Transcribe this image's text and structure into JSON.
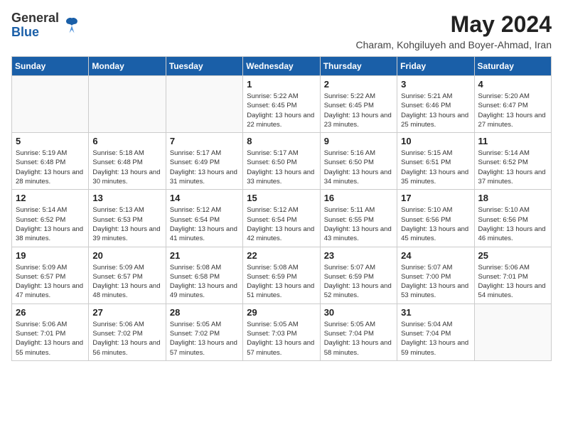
{
  "logo": {
    "general": "General",
    "blue": "Blue"
  },
  "title": "May 2024",
  "location": "Charam, Kohgiluyeh and Boyer-Ahmad, Iran",
  "days_of_week": [
    "Sunday",
    "Monday",
    "Tuesday",
    "Wednesday",
    "Thursday",
    "Friday",
    "Saturday"
  ],
  "weeks": [
    [
      {
        "day": "",
        "info": ""
      },
      {
        "day": "",
        "info": ""
      },
      {
        "day": "",
        "info": ""
      },
      {
        "day": "1",
        "sunrise": "5:22 AM",
        "sunset": "6:45 PM",
        "daylight": "13 hours and 22 minutes."
      },
      {
        "day": "2",
        "sunrise": "5:22 AM",
        "sunset": "6:45 PM",
        "daylight": "13 hours and 23 minutes."
      },
      {
        "day": "3",
        "sunrise": "5:21 AM",
        "sunset": "6:46 PM",
        "daylight": "13 hours and 25 minutes."
      },
      {
        "day": "4",
        "sunrise": "5:20 AM",
        "sunset": "6:47 PM",
        "daylight": "13 hours and 27 minutes."
      }
    ],
    [
      {
        "day": "5",
        "sunrise": "5:19 AM",
        "sunset": "6:48 PM",
        "daylight": "13 hours and 28 minutes."
      },
      {
        "day": "6",
        "sunrise": "5:18 AM",
        "sunset": "6:48 PM",
        "daylight": "13 hours and 30 minutes."
      },
      {
        "day": "7",
        "sunrise": "5:17 AM",
        "sunset": "6:49 PM",
        "daylight": "13 hours and 31 minutes."
      },
      {
        "day": "8",
        "sunrise": "5:17 AM",
        "sunset": "6:50 PM",
        "daylight": "13 hours and 33 minutes."
      },
      {
        "day": "9",
        "sunrise": "5:16 AM",
        "sunset": "6:50 PM",
        "daylight": "13 hours and 34 minutes."
      },
      {
        "day": "10",
        "sunrise": "5:15 AM",
        "sunset": "6:51 PM",
        "daylight": "13 hours and 35 minutes."
      },
      {
        "day": "11",
        "sunrise": "5:14 AM",
        "sunset": "6:52 PM",
        "daylight": "13 hours and 37 minutes."
      }
    ],
    [
      {
        "day": "12",
        "sunrise": "5:14 AM",
        "sunset": "6:52 PM",
        "daylight": "13 hours and 38 minutes."
      },
      {
        "day": "13",
        "sunrise": "5:13 AM",
        "sunset": "6:53 PM",
        "daylight": "13 hours and 39 minutes."
      },
      {
        "day": "14",
        "sunrise": "5:12 AM",
        "sunset": "6:54 PM",
        "daylight": "13 hours and 41 minutes."
      },
      {
        "day": "15",
        "sunrise": "5:12 AM",
        "sunset": "6:54 PM",
        "daylight": "13 hours and 42 minutes."
      },
      {
        "day": "16",
        "sunrise": "5:11 AM",
        "sunset": "6:55 PM",
        "daylight": "13 hours and 43 minutes."
      },
      {
        "day": "17",
        "sunrise": "5:10 AM",
        "sunset": "6:56 PM",
        "daylight": "13 hours and 45 minutes."
      },
      {
        "day": "18",
        "sunrise": "5:10 AM",
        "sunset": "6:56 PM",
        "daylight": "13 hours and 46 minutes."
      }
    ],
    [
      {
        "day": "19",
        "sunrise": "5:09 AM",
        "sunset": "6:57 PM",
        "daylight": "13 hours and 47 minutes."
      },
      {
        "day": "20",
        "sunrise": "5:09 AM",
        "sunset": "6:57 PM",
        "daylight": "13 hours and 48 minutes."
      },
      {
        "day": "21",
        "sunrise": "5:08 AM",
        "sunset": "6:58 PM",
        "daylight": "13 hours and 49 minutes."
      },
      {
        "day": "22",
        "sunrise": "5:08 AM",
        "sunset": "6:59 PM",
        "daylight": "13 hours and 51 minutes."
      },
      {
        "day": "23",
        "sunrise": "5:07 AM",
        "sunset": "6:59 PM",
        "daylight": "13 hours and 52 minutes."
      },
      {
        "day": "24",
        "sunrise": "5:07 AM",
        "sunset": "7:00 PM",
        "daylight": "13 hours and 53 minutes."
      },
      {
        "day": "25",
        "sunrise": "5:06 AM",
        "sunset": "7:01 PM",
        "daylight": "13 hours and 54 minutes."
      }
    ],
    [
      {
        "day": "26",
        "sunrise": "5:06 AM",
        "sunset": "7:01 PM",
        "daylight": "13 hours and 55 minutes."
      },
      {
        "day": "27",
        "sunrise": "5:06 AM",
        "sunset": "7:02 PM",
        "daylight": "13 hours and 56 minutes."
      },
      {
        "day": "28",
        "sunrise": "5:05 AM",
        "sunset": "7:02 PM",
        "daylight": "13 hours and 57 minutes."
      },
      {
        "day": "29",
        "sunrise": "5:05 AM",
        "sunset": "7:03 PM",
        "daylight": "13 hours and 57 minutes."
      },
      {
        "day": "30",
        "sunrise": "5:05 AM",
        "sunset": "7:04 PM",
        "daylight": "13 hours and 58 minutes."
      },
      {
        "day": "31",
        "sunrise": "5:04 AM",
        "sunset": "7:04 PM",
        "daylight": "13 hours and 59 minutes."
      },
      {
        "day": "",
        "info": ""
      }
    ]
  ],
  "labels": {
    "sunrise": "Sunrise:",
    "sunset": "Sunset:",
    "daylight": "Daylight:"
  }
}
